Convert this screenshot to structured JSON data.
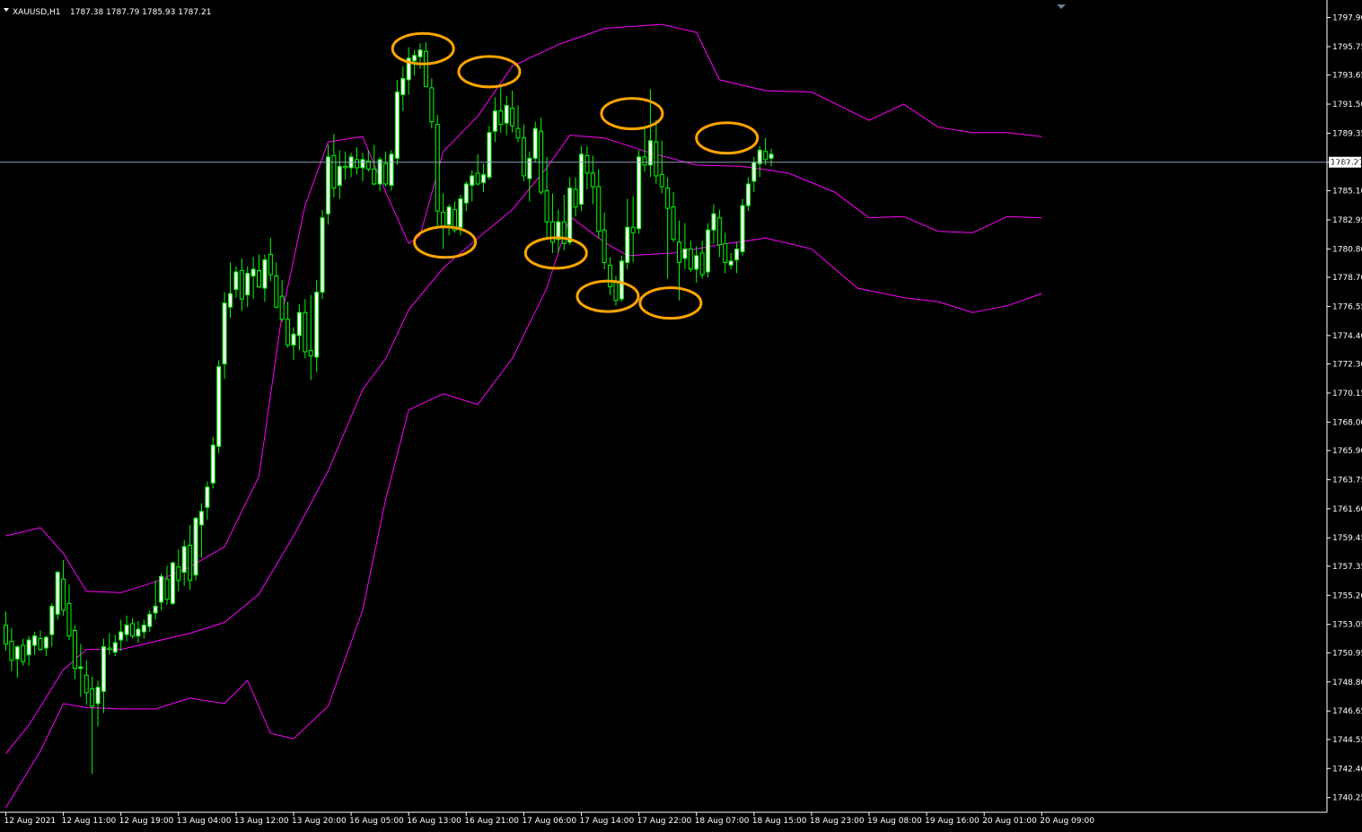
{
  "header": {
    "symbol_label": "XAUUSD,H1",
    "ohlc_text": "1787.38 1787.79 1785.93 1787.21"
  },
  "colors": {
    "background": "#000000",
    "axis": "#ffffff",
    "candle_up_body": "#ffffff",
    "candle_down_body": "#000000",
    "candle_outline": "#00ff00",
    "wick": "#00ff00",
    "bollinger": "#ff00ff",
    "current_price_line": "#8fa3b8",
    "annotation": "#ffa500"
  },
  "chart_data": {
    "type": "candlestick",
    "symbol": "XAUUSD",
    "timeframe": "H1",
    "ylim": [
      1739.5,
      1798.4
    ],
    "y_ticks": [
      "1797.90",
      "1795.75",
      "1793.65",
      "1791.50",
      "1789.35",
      "1787.21",
      "1785.10",
      "1782.95",
      "1780.80",
      "1778.70",
      "1776.55",
      "1774.40",
      "1772.30",
      "1770.15",
      "1768.00",
      "1765.90",
      "1763.75",
      "1761.60",
      "1759.45",
      "1757.35",
      "1755.20",
      "1753.05",
      "1750.95",
      "1748.80",
      "1746.65",
      "1744.55",
      "1742.40",
      "1740.25"
    ],
    "x_ticks": [
      {
        "label": "12 Aug 2021",
        "index": 0
      },
      {
        "label": "12 Aug 11:00",
        "index": 10
      },
      {
        "label": "12 Aug 19:00",
        "index": 20
      },
      {
        "label": "13 Aug 04:00",
        "index": 30
      },
      {
        "label": "13 Aug 12:00",
        "index": 40
      },
      {
        "label": "13 Aug 20:00",
        "index": 50
      },
      {
        "label": "16 Aug 05:00",
        "index": 60
      },
      {
        "label": "16 Aug 13:00",
        "index": 70
      },
      {
        "label": "16 Aug 21:00",
        "index": 80
      },
      {
        "label": "17 Aug 06:00",
        "index": 90
      },
      {
        "label": "17 Aug 14:00",
        "index": 100
      },
      {
        "label": "17 Aug 22:00",
        "index": 110
      },
      {
        "label": "18 Aug 07:00",
        "index": 120
      },
      {
        "label": "18 Aug 15:00",
        "index": 130
      },
      {
        "label": "18 Aug 23:00",
        "index": 140
      },
      {
        "label": "19 Aug 08:00",
        "index": 150
      },
      {
        "label": "19 Aug 16:00",
        "index": 160
      },
      {
        "label": "20 Aug 01:00",
        "index": 170
      },
      {
        "label": "20 Aug 09:00",
        "index": 180
      }
    ],
    "current_price": 1787.21,
    "current_price_label": "1787.21",
    "bollinger_bands": {
      "upper": [
        [
          0,
          1759.6
        ],
        [
          6,
          1760.2
        ],
        [
          10,
          1758.3
        ],
        [
          14,
          1755.5
        ],
        [
          20,
          1755.4
        ],
        [
          26,
          1756.2
        ],
        [
          32,
          1757.3
        ],
        [
          38,
          1758.8
        ],
        [
          44,
          1764
        ],
        [
          48,
          1776
        ],
        [
          52,
          1784
        ],
        [
          56,
          1788.7
        ],
        [
          62,
          1789.1
        ],
        [
          66,
          1785
        ],
        [
          70,
          1781.2
        ],
        [
          72,
          1781.8
        ],
        [
          76,
          1788
        ],
        [
          82,
          1790.6
        ],
        [
          88,
          1794.3
        ],
        [
          96,
          1795.9
        ],
        [
          104,
          1797.1
        ],
        [
          114,
          1797.4
        ],
        [
          120,
          1796.8
        ],
        [
          124,
          1793.3
        ],
        [
          132,
          1792.5
        ],
        [
          140,
          1792.4
        ],
        [
          150,
          1790.3
        ],
        [
          156,
          1791.5
        ],
        [
          162,
          1789.8
        ],
        [
          168,
          1789.4
        ],
        [
          174,
          1789.4
        ],
        [
          180,
          1789.1
        ]
      ],
      "middle": [
        [
          0,
          1743.5
        ],
        [
          4,
          1745.6
        ],
        [
          10,
          1749.7
        ],
        [
          14,
          1751.2
        ],
        [
          20,
          1751.2
        ],
        [
          26,
          1751.8
        ],
        [
          32,
          1752.4
        ],
        [
          38,
          1753.2
        ],
        [
          44,
          1755.3
        ],
        [
          50,
          1759.6
        ],
        [
          56,
          1764.4
        ],
        [
          62,
          1770.4
        ],
        [
          66,
          1772.7
        ],
        [
          70,
          1776.3
        ],
        [
          76,
          1779.4
        ],
        [
          82,
          1781.6
        ],
        [
          88,
          1783.7
        ],
        [
          94,
          1786.8
        ],
        [
          98,
          1789.2
        ],
        [
          104,
          1789.0
        ],
        [
          112,
          1787.9
        ],
        [
          120,
          1787.0
        ],
        [
          128,
          1786.9
        ],
        [
          136,
          1786.4
        ],
        [
          144,
          1785.0
        ],
        [
          150,
          1783.1
        ],
        [
          156,
          1783.2
        ],
        [
          162,
          1782.1
        ],
        [
          168,
          1782.0
        ],
        [
          174,
          1783.2
        ],
        [
          180,
          1783.1
        ]
      ],
      "lower": [
        [
          0,
          1739.5
        ],
        [
          6,
          1743.7
        ],
        [
          10,
          1747.2
        ],
        [
          14,
          1746.9
        ],
        [
          20,
          1746.8
        ],
        [
          26,
          1746.8
        ],
        [
          32,
          1747.6
        ],
        [
          38,
          1747.2
        ],
        [
          42,
          1748.9
        ],
        [
          46,
          1745
        ],
        [
          50,
          1744.6
        ],
        [
          56,
          1747
        ],
        [
          62,
          1754.1
        ],
        [
          66,
          1762.3
        ],
        [
          70,
          1768.9
        ],
        [
          76,
          1770.1
        ],
        [
          82,
          1769.3
        ],
        [
          88,
          1772.7
        ],
        [
          94,
          1777.9
        ],
        [
          98,
          1783.2
        ],
        [
          104,
          1781.3
        ],
        [
          108,
          1780.3
        ],
        [
          116,
          1780.5
        ],
        [
          124,
          1781.1
        ],
        [
          132,
          1781.6
        ],
        [
          140,
          1780.8
        ],
        [
          148,
          1777.9
        ],
        [
          156,
          1777.2
        ],
        [
          162,
          1776.9
        ],
        [
          168,
          1776.1
        ],
        [
          174,
          1776.6
        ],
        [
          180,
          1777.5
        ]
      ]
    },
    "candles": [
      [
        1753.0,
        1754.0,
        1751.1,
        1751.6
      ],
      [
        1751.8,
        1752.8,
        1749.6,
        1750.4
      ],
      [
        1750.5,
        1751.5,
        1749.1,
        1751.4
      ],
      [
        1751.5,
        1752.0,
        1750.0,
        1750.3
      ],
      [
        1750.8,
        1752.2,
        1750.0,
        1751.9
      ],
      [
        1751.5,
        1752.5,
        1750.8,
        1752.2
      ],
      [
        1752.0,
        1752.6,
        1751.1,
        1751.2
      ],
      [
        1751.3,
        1752.2,
        1750.7,
        1752.1
      ],
      [
        1752.3,
        1754.6,
        1751.4,
        1754.4
      ],
      [
        1753.8,
        1757.0,
        1753.4,
        1756.9
      ],
      [
        1756.4,
        1757.8,
        1753.7,
        1754.1
      ],
      [
        1754.6,
        1756.0,
        1751.9,
        1752.2
      ],
      [
        1752.6,
        1753.0,
        1749.0,
        1749.8
      ],
      [
        1749.8,
        1751.6,
        1747.7,
        1749.9
      ],
      [
        1749.3,
        1750.4,
        1747.1,
        1748.0
      ],
      [
        1748.3,
        1749.2,
        1742.0,
        1747.0
      ],
      [
        1747.2,
        1748.9,
        1745.5,
        1748.4
      ],
      [
        1748.1,
        1752.0,
        1746.5,
        1751.4
      ],
      [
        1751.3,
        1752.4,
        1750.8,
        1751.2
      ],
      [
        1751.0,
        1752.3,
        1750.7,
        1751.7
      ],
      [
        1751.9,
        1753.4,
        1751.1,
        1752.5
      ],
      [
        1752.3,
        1753.7,
        1751.8,
        1753.0
      ],
      [
        1753.1,
        1753.5,
        1752.0,
        1752.2
      ],
      [
        1752.2,
        1753.3,
        1751.7,
        1752.7
      ],
      [
        1752.5,
        1753.4,
        1752.0,
        1753.0
      ],
      [
        1752.9,
        1754.1,
        1752.5,
        1753.8
      ],
      [
        1753.9,
        1756.3,
        1753.4,
        1754.4
      ],
      [
        1754.7,
        1756.8,
        1754.1,
        1756.6
      ],
      [
        1756.4,
        1757.4,
        1754.5,
        1754.9
      ],
      [
        1754.6,
        1757.7,
        1754.5,
        1757.6
      ],
      [
        1757.3,
        1758.6,
        1755.5,
        1756.3
      ],
      [
        1756.9,
        1759.3,
        1755.9,
        1758.8
      ],
      [
        1758.9,
        1760.4,
        1755.6,
        1756.3
      ],
      [
        1756.7,
        1761.0,
        1756.3,
        1760.9
      ],
      [
        1760.4,
        1762.0,
        1758.0,
        1761.4
      ],
      [
        1761.7,
        1763.6,
        1760.8,
        1763.2
      ],
      [
        1763.5,
        1766.9,
        1763.1,
        1766.3
      ],
      [
        1766.2,
        1772.6,
        1765.7,
        1772.1
      ],
      [
        1772.3,
        1777.6,
        1771.2,
        1776.8
      ],
      [
        1776.5,
        1779.8,
        1775.7,
        1777.5
      ],
      [
        1777.8,
        1779.5,
        1777.2,
        1779.1
      ],
      [
        1779.2,
        1780.1,
        1776.2,
        1777.1
      ],
      [
        1777.4,
        1779.5,
        1776.5,
        1779.0
      ],
      [
        1778.8,
        1780.2,
        1777.1,
        1779.3
      ],
      [
        1779.2,
        1780.4,
        1777.9,
        1778.0
      ],
      [
        1777.9,
        1780.4,
        1776.9,
        1780.0
      ],
      [
        1780.4,
        1781.6,
        1778.4,
        1778.9
      ],
      [
        1778.8,
        1779.8,
        1776.4,
        1776.5
      ],
      [
        1777.3,
        1778.5,
        1775.4,
        1775.6
      ],
      [
        1775.6,
        1776.9,
        1773.5,
        1773.7
      ],
      [
        1773.7,
        1775.0,
        1772.6,
        1774.5
      ],
      [
        1774.4,
        1776.7,
        1773.3,
        1776.1
      ],
      [
        1776.1,
        1777.1,
        1772.7,
        1773.2
      ],
      [
        1773.3,
        1777.4,
        1771.1,
        1772.9
      ],
      [
        1772.8,
        1778.5,
        1771.7,
        1777.6
      ],
      [
        1777.6,
        1783.7,
        1777.1,
        1783.1
      ],
      [
        1783.4,
        1788.5,
        1782.6,
        1787.6
      ],
      [
        1787.7,
        1789.3,
        1784.6,
        1785.3
      ],
      [
        1785.5,
        1788.1,
        1784.5,
        1786.9
      ],
      [
        1786.9,
        1788.0,
        1785.9,
        1786.8
      ],
      [
        1786.8,
        1787.9,
        1786.1,
        1787.6
      ],
      [
        1787.4,
        1788.3,
        1786.3,
        1786.8
      ],
      [
        1786.8,
        1787.9,
        1785.8,
        1787.4
      ],
      [
        1787.3,
        1788.1,
        1786.5,
        1786.7
      ],
      [
        1786.7,
        1788.5,
        1785.5,
        1785.6
      ],
      [
        1785.6,
        1787.6,
        1785.1,
        1787.4
      ],
      [
        1787.1,
        1788.0,
        1785.4,
        1785.6
      ],
      [
        1785.5,
        1788.1,
        1785.1,
        1787.8
      ],
      [
        1787.5,
        1793.3,
        1787.0,
        1792.4
      ],
      [
        1792.2,
        1794.3,
        1791.0,
        1793.4
      ],
      [
        1793.3,
        1795.7,
        1792.2,
        1794.9
      ],
      [
        1794.7,
        1795.5,
        1793.6,
        1795.1
      ],
      [
        1795.0,
        1796.0,
        1794.1,
        1795.5
      ],
      [
        1795.4,
        1796.1,
        1793.2,
        1792.8
      ],
      [
        1792.7,
        1793.4,
        1789.7,
        1790.2
      ],
      [
        1790.0,
        1790.7,
        1782.5,
        1783.6
      ],
      [
        1783.5,
        1784.9,
        1780.8,
        1782.5
      ],
      [
        1782.6,
        1784.1,
        1781.8,
        1783.9
      ],
      [
        1783.7,
        1784.3,
        1782.0,
        1782.2
      ],
      [
        1782.4,
        1784.8,
        1781.8,
        1784.5
      ],
      [
        1784.2,
        1785.8,
        1783.6,
        1785.6
      ],
      [
        1785.5,
        1786.6,
        1784.3,
        1786.2
      ],
      [
        1786.4,
        1787.8,
        1785.5,
        1785.6
      ],
      [
        1785.7,
        1787.1,
        1785.0,
        1786.3
      ],
      [
        1786.1,
        1789.9,
        1785.9,
        1789.4
      ],
      [
        1789.5,
        1792.0,
        1788.7,
        1791.0
      ],
      [
        1791.0,
        1792.8,
        1789.4,
        1790.0
      ],
      [
        1790.1,
        1792.1,
        1789.2,
        1791.4
      ],
      [
        1791.2,
        1792.5,
        1789.4,
        1789.9
      ],
      [
        1789.7,
        1791.4,
        1788.7,
        1789.0
      ],
      [
        1789.0,
        1790.0,
        1785.8,
        1786.2
      ],
      [
        1786.0,
        1788.0,
        1784.3,
        1787.5
      ],
      [
        1787.5,
        1790.2,
        1787.2,
        1789.7
      ],
      [
        1789.5,
        1790.5,
        1784.8,
        1785.0
      ],
      [
        1785.1,
        1787.6,
        1781.6,
        1782.8
      ],
      [
        1782.8,
        1784.9,
        1780.5,
        1781.3
      ],
      [
        1781.5,
        1783.7,
        1780.5,
        1782.8
      ],
      [
        1782.8,
        1784.8,
        1780.7,
        1781.2
      ],
      [
        1781.3,
        1786.1,
        1781.1,
        1785.3
      ],
      [
        1785.2,
        1786.1,
        1783.2,
        1783.9
      ],
      [
        1784.1,
        1788.4,
        1783.6,
        1787.8
      ],
      [
        1787.7,
        1788.4,
        1785.2,
        1786.4
      ],
      [
        1786.4,
        1787.7,
        1784.1,
        1785.4
      ],
      [
        1785.4,
        1786.7,
        1781.6,
        1782.1
      ],
      [
        1782.2,
        1783.5,
        1779.3,
        1779.8
      ],
      [
        1779.6,
        1780.2,
        1777.4,
        1778.0
      ],
      [
        1778.3,
        1778.8,
        1776.6,
        1777.0
      ],
      [
        1777.1,
        1780.3,
        1776.9,
        1779.9
      ],
      [
        1779.8,
        1784.5,
        1779.3,
        1782.4
      ],
      [
        1782.4,
        1784.7,
        1779.8,
        1782.0
      ],
      [
        1782.3,
        1788.1,
        1781.9,
        1787.6
      ],
      [
        1787.6,
        1789.8,
        1786.5,
        1787.0
      ],
      [
        1787.0,
        1792.6,
        1786.1,
        1788.8
      ],
      [
        1788.7,
        1790.3,
        1785.6,
        1786.2
      ],
      [
        1786.3,
        1788.8,
        1784.9,
        1785.4
      ],
      [
        1785.3,
        1786.1,
        1778.6,
        1783.8
      ],
      [
        1783.9,
        1785.0,
        1781.3,
        1781.5
      ],
      [
        1781.3,
        1782.9,
        1777.0,
        1779.8
      ],
      [
        1780.1,
        1782.7,
        1779.3,
        1780.8
      ],
      [
        1780.8,
        1781.4,
        1779.1,
        1779.3
      ],
      [
        1779.3,
        1781.0,
        1778.3,
        1780.3
      ],
      [
        1780.5,
        1781.4,
        1778.6,
        1778.9
      ],
      [
        1779.1,
        1782.7,
        1778.7,
        1782.2
      ],
      [
        1782.2,
        1784.1,
        1781.2,
        1783.4
      ],
      [
        1783.1,
        1783.7,
        1780.2,
        1781.1
      ],
      [
        1781.2,
        1782.0,
        1779.0,
        1779.8
      ],
      [
        1779.6,
        1780.5,
        1779.3,
        1779.9
      ],
      [
        1780.0,
        1781.3,
        1779.0,
        1780.8
      ],
      [
        1780.6,
        1784.5,
        1780.3,
        1784.0
      ],
      [
        1784.0,
        1786.1,
        1783.6,
        1785.6
      ],
      [
        1785.8,
        1787.6,
        1785.0,
        1787.2
      ],
      [
        1787.1,
        1788.4,
        1786.1,
        1788.1
      ],
      [
        1788.0,
        1789.0,
        1787.0,
        1787.4
      ],
      [
        1787.5,
        1788.2,
        1786.9,
        1787.8
      ]
    ],
    "annotations": [
      {
        "label": "peak",
        "index": 72.5,
        "price": 1795.6
      },
      {
        "label": "peak",
        "index": 84.0,
        "price": 1793.9
      },
      {
        "label": "peak",
        "index": 108.8,
        "price": 1790.8
      },
      {
        "label": "peak",
        "index": 125.3,
        "price": 1789.0
      },
      {
        "label": "trough",
        "index": 76.3,
        "price": 1781.3
      },
      {
        "label": "trough",
        "index": 95.6,
        "price": 1780.5
      },
      {
        "label": "trough",
        "index": 104.6,
        "price": 1777.3
      },
      {
        "label": "trough",
        "index": 115.5,
        "price": 1776.8
      }
    ]
  }
}
